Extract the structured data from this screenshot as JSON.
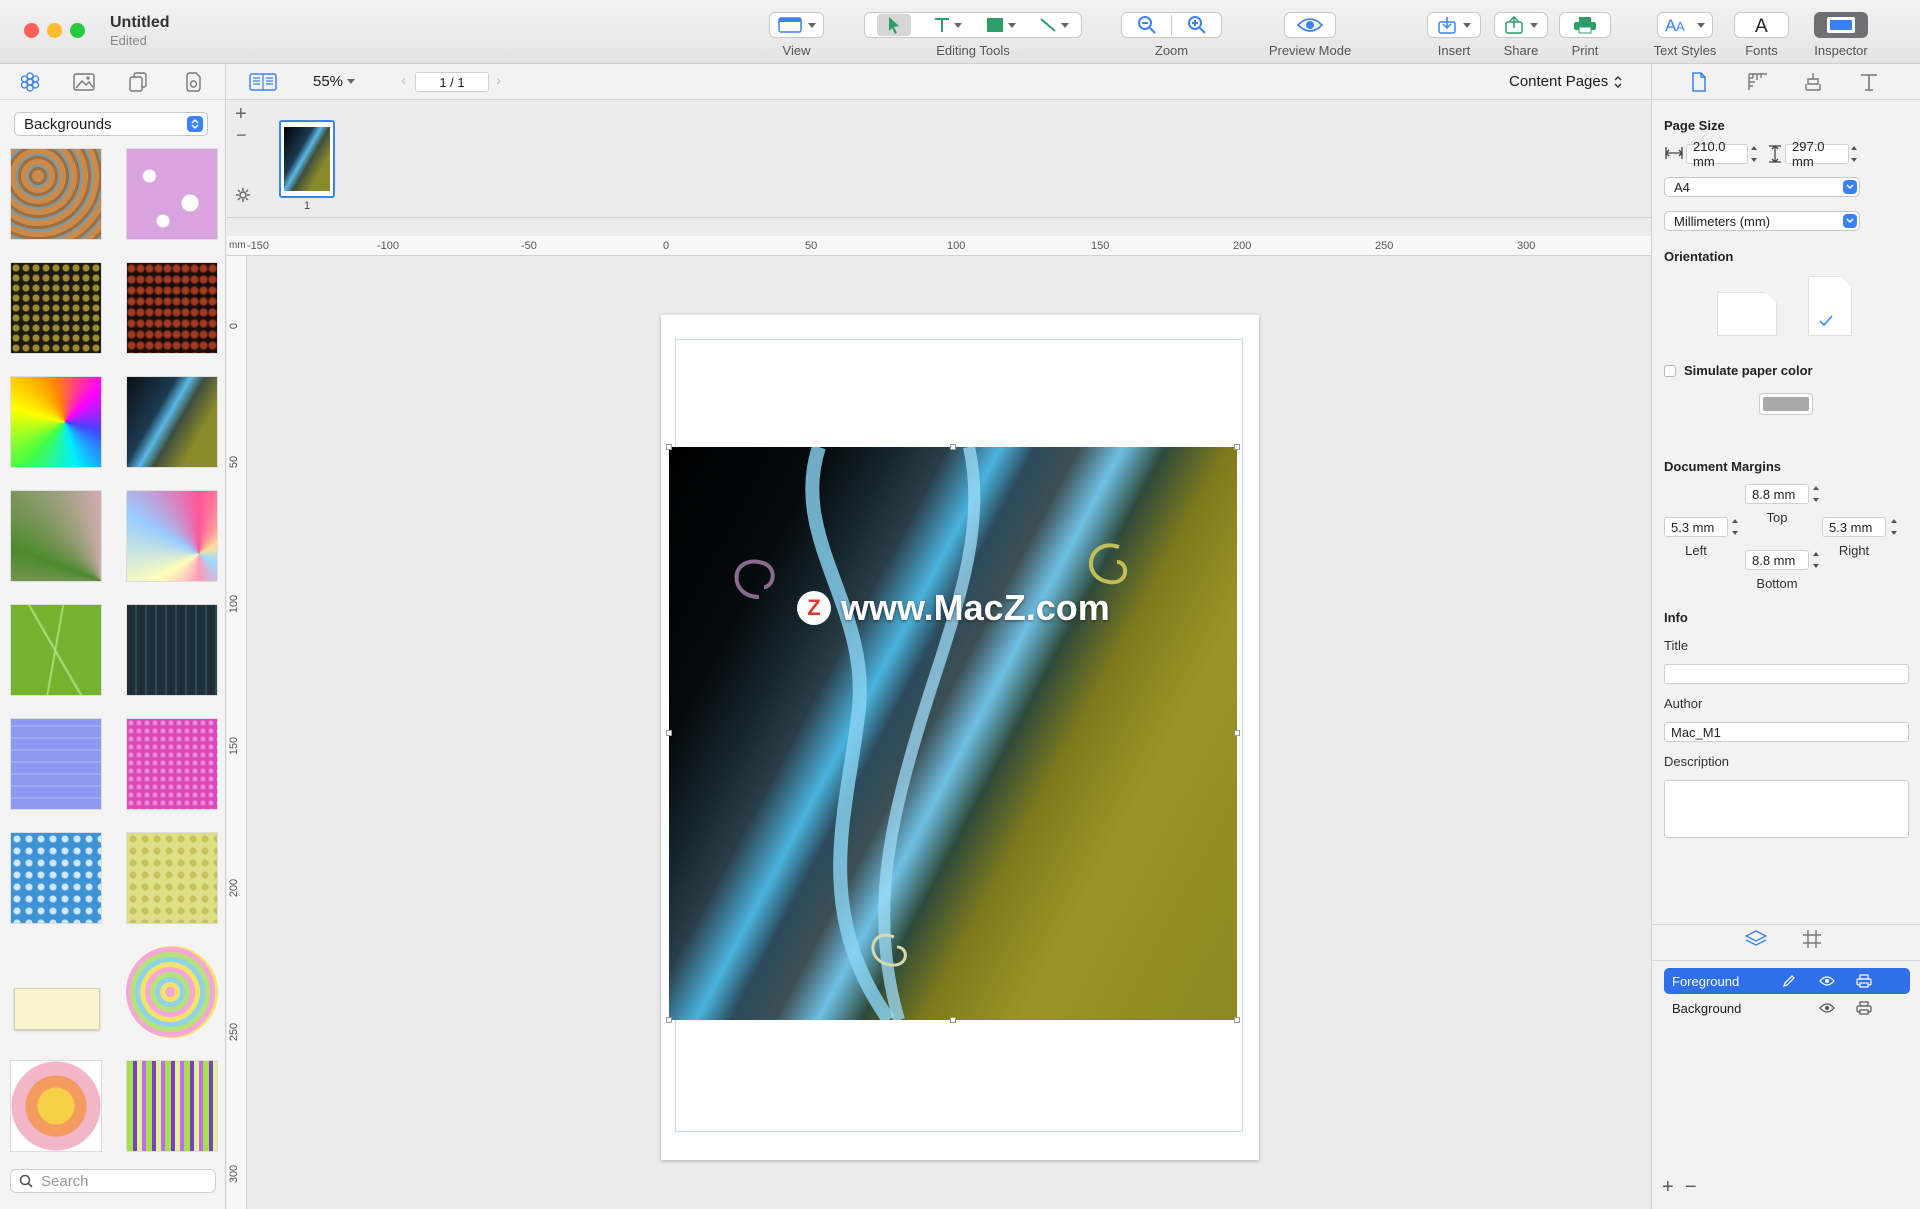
{
  "window": {
    "title": "Untitled",
    "subtitle": "Edited"
  },
  "toolbar": {
    "view": "View",
    "editing_tools": "Editing Tools",
    "zoom": "Zoom",
    "preview_mode": "Preview Mode",
    "insert": "Insert",
    "share": "Share",
    "print": "Print",
    "text_styles": "Text Styles",
    "fonts": "Fonts",
    "inspector": "Inspector"
  },
  "sidebar": {
    "category": "Backgrounds",
    "search_placeholder": "Search",
    "thumbnails": [
      "brown-mosaic",
      "pink-flowers",
      "gold-dots",
      "red-leaves",
      "rainbow-swirl",
      "dark-wave",
      "pink-green-burst",
      "pastel-rays",
      "green-lines",
      "dark-maze",
      "lavender-maze",
      "magenta-tiles",
      "blue-flowers",
      "yellow-floral",
      "cream-paper",
      "rainbow-spiral",
      "orange-star",
      "green-purple-stripes"
    ]
  },
  "canvas_bar": {
    "zoom": "55%",
    "page": "1 / 1",
    "mode": "Content Pages"
  },
  "pages": {
    "thumb_label": "1",
    "add": "+",
    "remove": "−"
  },
  "ruler": {
    "unit": "mm",
    "h_ticks": [
      "-150",
      "-100",
      "-50",
      "0",
      "50",
      "100",
      "150",
      "200",
      "250",
      "300"
    ],
    "v_ticks": [
      "0",
      "50",
      "100",
      "150",
      "200",
      "250",
      "300"
    ]
  },
  "watermark": {
    "badge": "Z",
    "text": "www.MacZ.com"
  },
  "inspector": {
    "page_size": {
      "heading": "Page Size",
      "width": "210.0 mm",
      "height": "297.0 mm",
      "preset": "A4",
      "units": "Millimeters (mm)"
    },
    "orientation": {
      "heading": "Orientation",
      "selected": "portrait"
    },
    "simulate_paper": {
      "label": "Simulate paper color",
      "checked": false,
      "swatch": "#a9a9a9"
    },
    "margins": {
      "heading": "Document Margins",
      "top": "8.8 mm",
      "top_label": "Top",
      "left": "5.3 mm",
      "left_label": "Left",
      "right": "5.3 mm",
      "right_label": "Right",
      "bottom": "8.8 mm",
      "bottom_label": "Bottom"
    },
    "info": {
      "heading": "Info",
      "title_label": "Title",
      "title_value": "",
      "author_label": "Author",
      "author_value": "Mac_M1",
      "description_label": "Description",
      "description_value": ""
    },
    "layers": [
      {
        "name": "Foreground",
        "selected": true
      },
      {
        "name": "Background",
        "selected": false
      }
    ]
  },
  "colors": {
    "accent": "#2f6fea",
    "selected_layer": "#2f6fea",
    "close": "#fe5f57",
    "minimize": "#febc2e",
    "zoom": "#28c840"
  }
}
